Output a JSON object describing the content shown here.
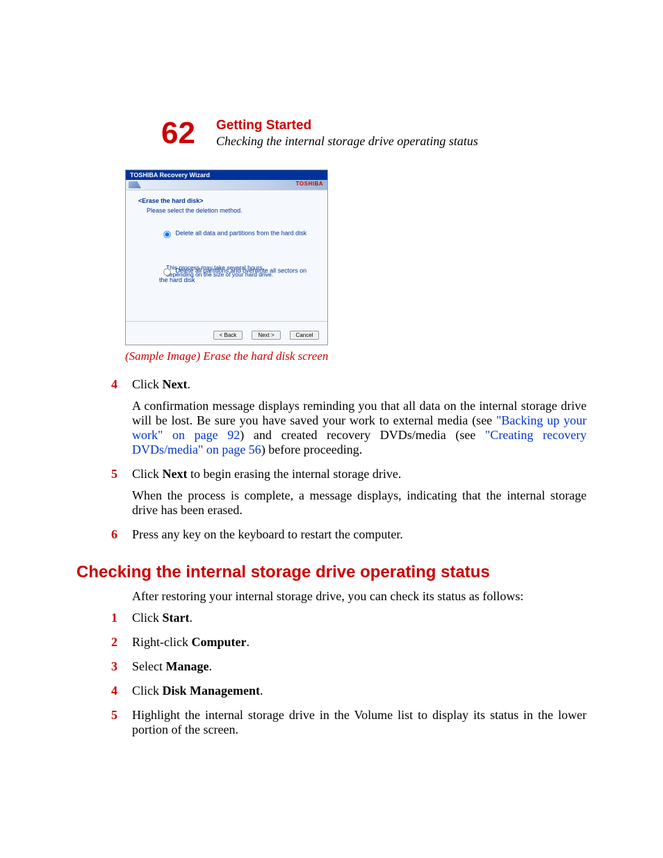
{
  "header": {
    "page_number": "62",
    "title": "Getting Started",
    "subtitle": "Checking the internal storage drive operating status"
  },
  "screenshot": {
    "window_title": "TOSHIBA Recovery Wizard",
    "brand": "TOSHIBA",
    "section_title": "<Erase the hard disk>",
    "instruction": "Please select the deletion method.",
    "option1": "Delete all data and partitions from the hard disk",
    "option2": "Delete all partitions and overwrite all sectors on the hard disk",
    "note_line1": "This process may take several hours,",
    "note_line2": "depending on the size of your hard drive.",
    "btn_back": "< Back",
    "btn_next": "Next >",
    "btn_cancel": "Cancel"
  },
  "caption": "(Sample Image) Erase the hard disk screen",
  "step4": {
    "num": "4",
    "line1_a": "Click ",
    "line1_b": "Next",
    "line1_c": ".",
    "para_a": "A confirmation message displays reminding you that all data on the internal storage drive will be lost. Be sure you have saved your work to external media (see ",
    "link1": "\"Backing up your work\" on page 92",
    "para_b": ") and created recovery DVDs/media (see ",
    "link2": "\"Creating recovery DVDs/media\" on page 56",
    "para_c": ") before proceeding."
  },
  "step5": {
    "num": "5",
    "line1_a": "Click ",
    "line1_b": "Next",
    "line1_c": " to begin erasing the internal storage drive.",
    "para": "When the process is complete, a message displays, indicating that the internal storage drive has been erased."
  },
  "step6": {
    "num": "6",
    "text": "Press any key on the keyboard to restart the computer."
  },
  "section_heading": "Checking the internal storage drive operating status",
  "intro": "After restoring your internal storage drive, you can check its status as follows:",
  "c1": {
    "num": "1",
    "a": "Click ",
    "b": "Start",
    "c": "."
  },
  "c2": {
    "num": "2",
    "a": "Right-click ",
    "b": "Computer",
    "c": "."
  },
  "c3": {
    "num": "3",
    "a": "Select ",
    "b": "Manage",
    "c": "."
  },
  "c4": {
    "num": "4",
    "a": "Click ",
    "b": "Disk Management",
    "c": "."
  },
  "c5": {
    "num": "5",
    "text": "Highlight the internal storage drive in the Volume list to display its status in the lower portion of the screen."
  }
}
